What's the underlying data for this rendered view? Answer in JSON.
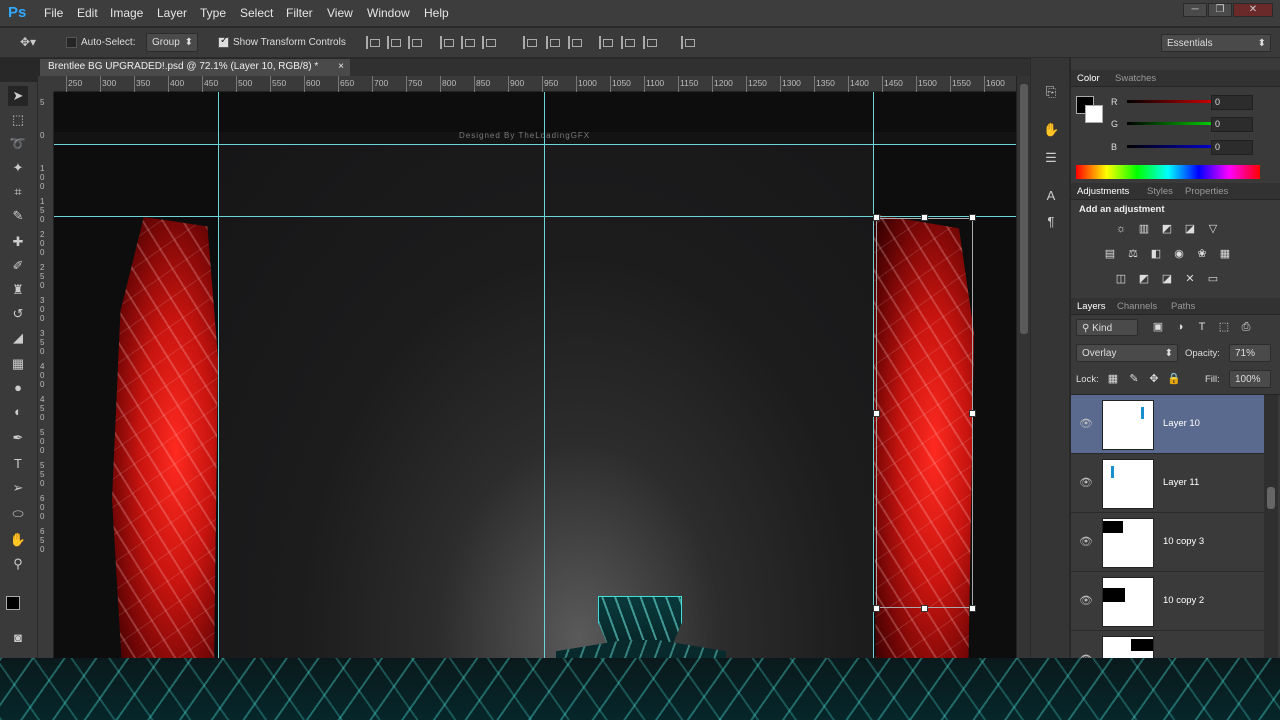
{
  "app": {
    "logo": "Ps",
    "menu": [
      "File",
      "Edit",
      "Image",
      "Layer",
      "Type",
      "Select",
      "Filter",
      "View",
      "Window",
      "Help"
    ],
    "window_controls": [
      "─",
      "❐",
      "✕"
    ]
  },
  "options_bar": {
    "auto_select_label": "Auto-Select:",
    "auto_select_value": "Group",
    "show_transform_label": "Show Transform Controls",
    "workspace": "Essentials"
  },
  "document_tab": {
    "title": "Brentlee BG UPGRADED!.psd @ 72.1% (Layer 10, RGB/8) *",
    "close": "×"
  },
  "ruler": {
    "top_ticks": [
      "250",
      "300",
      "350",
      "400",
      "450",
      "500",
      "550",
      "600",
      "650",
      "700",
      "750",
      "800",
      "850",
      "900",
      "950",
      "1000",
      "1050",
      "1100",
      "1150",
      "1200",
      "1250",
      "1300",
      "1350",
      "1400",
      "1450",
      "1500",
      "1550",
      "1600"
    ],
    "left_ticks": [
      "5",
      "0",
      "1\n0\n0",
      "1\n5\n0",
      "2\n0\n0",
      "2\n5\n0",
      "3\n0\n0",
      "3\n5\n0",
      "4\n0\n0",
      "4\n5\n0",
      "5\n0\n0",
      "5\n5\n0",
      "6\n0\n0",
      "6\n5\n0"
    ]
  },
  "canvas": {
    "credit_text": "Designed By TheLoadingGFX"
  },
  "tools": [
    "move-tool",
    "marquee-tool",
    "lasso-tool",
    "magic-wand-tool",
    "crop-tool",
    "eyedropper-tool",
    "healing-tool",
    "brush-tool",
    "stamp-tool",
    "history-brush-tool",
    "eraser-tool",
    "gradient-tool",
    "blur-tool",
    "dodge-tool",
    "pen-tool",
    "type-tool",
    "path-select-tool",
    "shape-tool",
    "hand-tool",
    "zoom-tool"
  ],
  "color_panel": {
    "tabs": [
      "Color",
      "Swatches"
    ],
    "channels": [
      {
        "label": "R",
        "value": "0",
        "color": "#ff0000"
      },
      {
        "label": "G",
        "value": "0",
        "color": "#00ff00"
      },
      {
        "label": "B",
        "value": "0",
        "color": "#0000ff"
      }
    ]
  },
  "adjustments_panel": {
    "tabs": [
      "Adjustments",
      "Styles",
      "Properties"
    ],
    "heading": "Add an adjustment"
  },
  "layers_panel": {
    "tabs": [
      "Layers",
      "Channels",
      "Paths"
    ],
    "filter_kind": "Kind",
    "blend_mode": "Overlay",
    "opacity_label": "Opacity:",
    "opacity_value": "71%",
    "lock_label": "Lock:",
    "fill_label": "Fill:",
    "fill_value": "100%",
    "layers": [
      {
        "name": "Layer 10",
        "selected": true
      },
      {
        "name": "Layer 11",
        "selected": false
      },
      {
        "name": "10 copy 3",
        "selected": false
      },
      {
        "name": "10 copy 2",
        "selected": false
      },
      {
        "name": "",
        "selected": false
      }
    ]
  },
  "colors": {
    "accent_guides": "#6fd3d8",
    "selected_layer": "#5a6a8e",
    "red_art": "#e8160f",
    "teal_art": "#3de0d8"
  }
}
